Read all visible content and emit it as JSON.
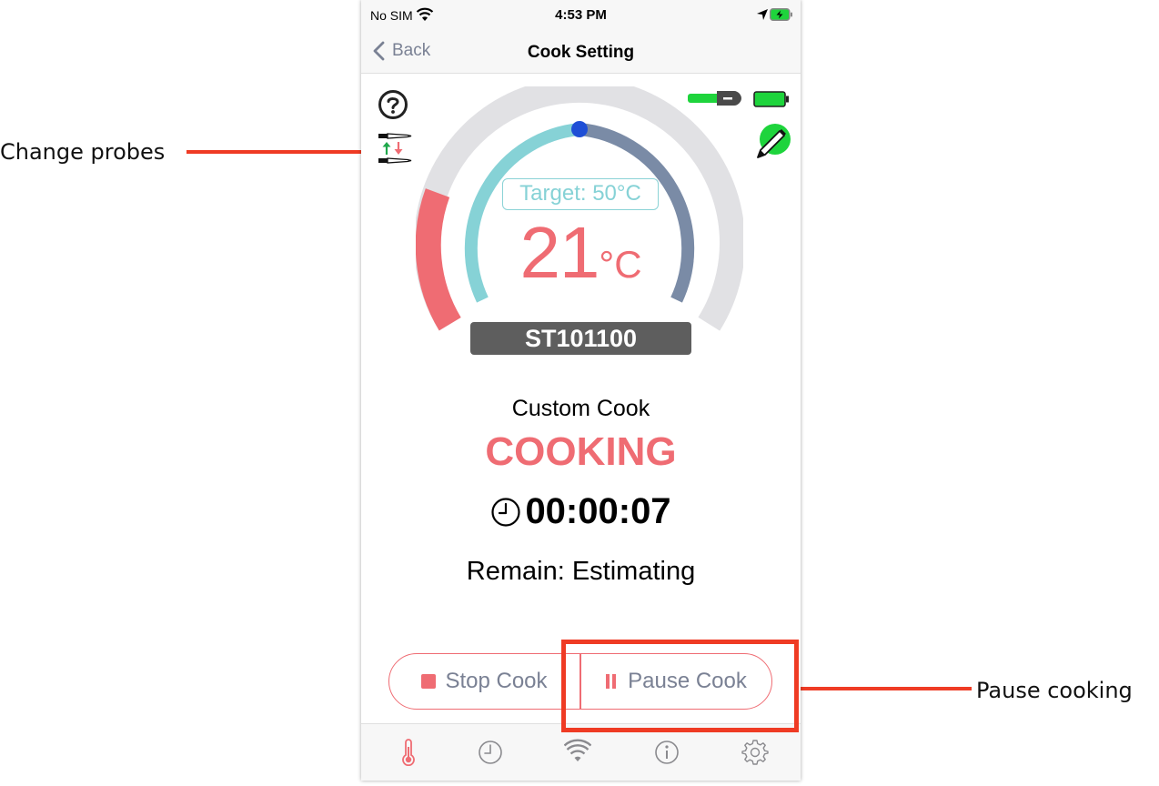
{
  "annotations": {
    "change_probes": "Change probes",
    "pause_cooking": "Pause cooking"
  },
  "status_bar": {
    "carrier": "No SIM",
    "time": "4:53 PM"
  },
  "nav": {
    "back_label": "Back",
    "title": "Cook Setting"
  },
  "gauge": {
    "target_label": "Target: 50°C",
    "current_temp": "21",
    "temp_unit": "°C",
    "device_id": "ST101100"
  },
  "cook": {
    "type": "Custom Cook",
    "status": "COOKING",
    "elapsed": "00:00:07",
    "remain": "Remain: Estimating"
  },
  "actions": {
    "stop_label": "Stop Cook",
    "pause_label": "Pause Cook"
  },
  "tabs": [
    "thermometer-icon",
    "clock-icon",
    "wifi-icon",
    "info-icon",
    "gear-icon"
  ],
  "colors": {
    "accent": "#ef6c73",
    "teal": "#86d2d6",
    "slate": "#7a8ba6",
    "highlight": "#ef3b24",
    "ok_green": "#1ed43c"
  }
}
